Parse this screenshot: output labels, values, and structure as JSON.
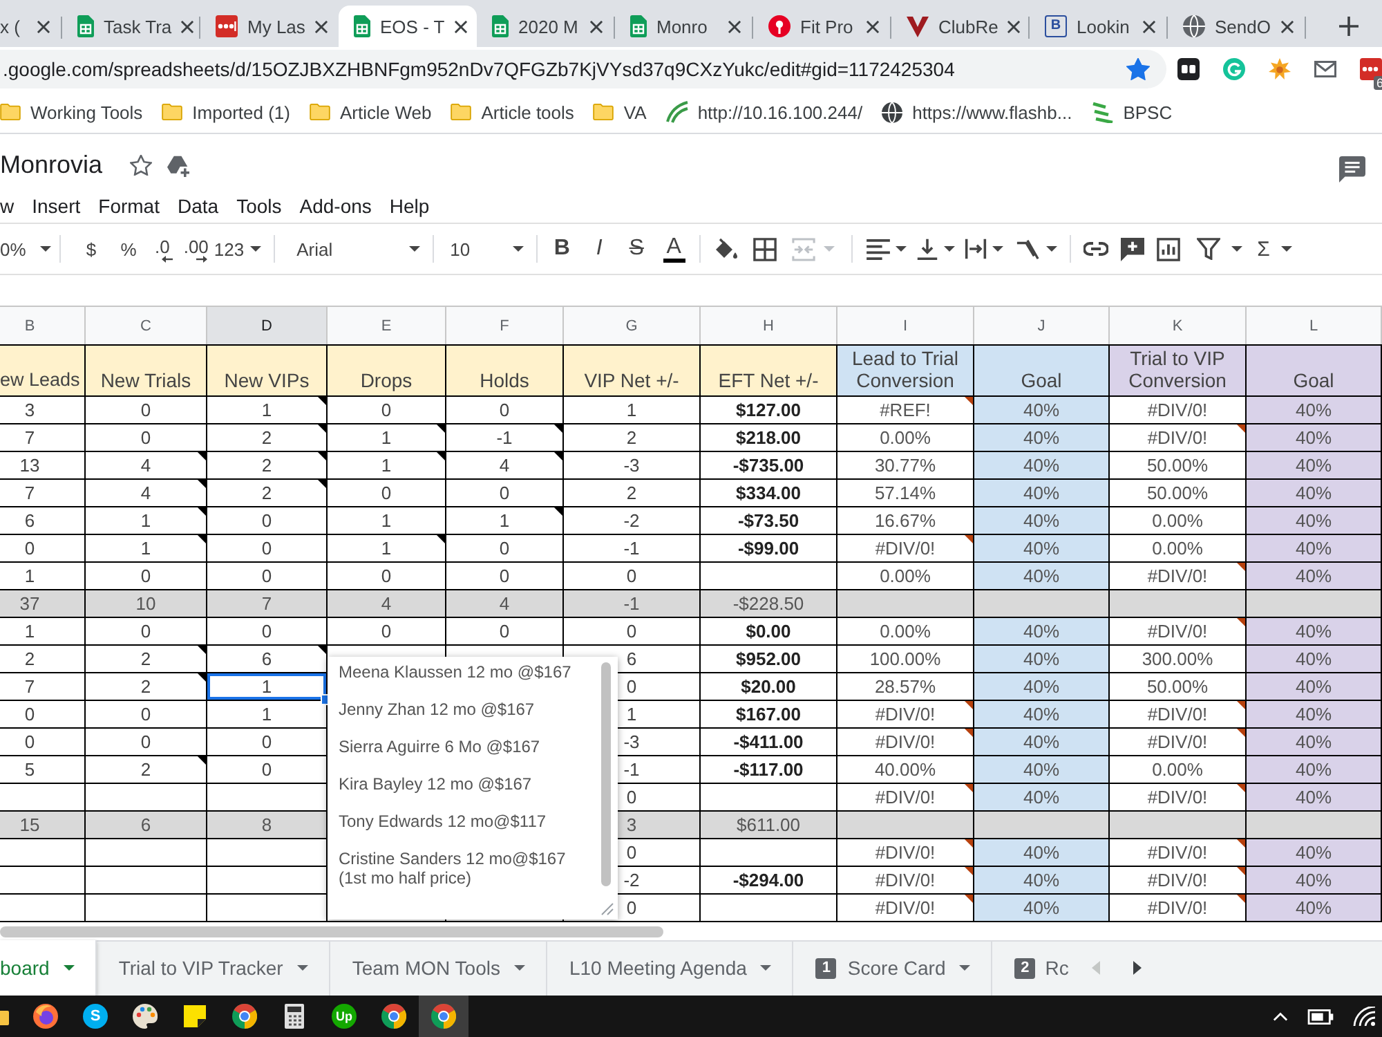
{
  "browser": {
    "tabs": [
      {
        "title": "x (",
        "kind": "none",
        "selected": false
      },
      {
        "title": "Task Tra",
        "kind": "sheets",
        "selected": false
      },
      {
        "title": "My Las",
        "kind": "dots",
        "selected": false
      },
      {
        "title": "EOS - T",
        "kind": "sheets",
        "selected": true
      },
      {
        "title": "2020 M",
        "kind": "sheets",
        "selected": false
      },
      {
        "title": "Monro",
        "kind": "sheets",
        "selected": false
      },
      {
        "title": "Fit Pro",
        "kind": "pin",
        "selected": false
      },
      {
        "title": "ClubRe",
        "kind": "vmark",
        "selected": false
      },
      {
        "title": "Lookin",
        "kind": "letter",
        "letter": "B",
        "selected": false
      },
      {
        "title": "SendO",
        "kind": "globe",
        "selected": false
      }
    ],
    "url": ".google.com/spreadsheets/d/15OZJBXZHBNFgm952nDv7QFGZb7KjVYsd37q9CXzYukc/edit#gid=1172425304",
    "bookmarked": true,
    "extension_badge": "6",
    "bookmarks": [
      {
        "label": "Working Tools",
        "kind": "folder"
      },
      {
        "label": "Imported (1)",
        "kind": "folder"
      },
      {
        "label": "Article Web",
        "kind": "folder"
      },
      {
        "label": "Article tools",
        "kind": "folder"
      },
      {
        "label": "VA",
        "kind": "folder"
      },
      {
        "label": "http://10.16.100.244/",
        "kind": "swoosh"
      },
      {
        "label": "https://www.flashb...",
        "kind": "globe"
      },
      {
        "label": "BPSC",
        "kind": "stripes"
      }
    ]
  },
  "document": {
    "title": "Monrovia",
    "starred": false,
    "menu": [
      "w",
      "Insert",
      "Format",
      "Data",
      "Tools",
      "Add-ons",
      "Help"
    ],
    "toolbar": {
      "zoom": "0%",
      "currency": "$",
      "percent": "%",
      "decimals_less": ".0",
      "decimals_more": ".00",
      "number_format": "123",
      "font": "Arial",
      "font_size": "10",
      "bold": "B",
      "italic": "I",
      "strikethrough": "S",
      "text_color": "A",
      "merge_disabled": true,
      "functions": "Σ"
    }
  },
  "sheet": {
    "columns": [
      {
        "letter": "B",
        "header": "ew Leads",
        "color": "#fff2cc",
        "filled": false,
        "selected": false
      },
      {
        "letter": "C",
        "header": "New Trials",
        "color": "#fff2cc",
        "filled": false,
        "selected": false
      },
      {
        "letter": "D",
        "header": "New VIPs",
        "color": "#fff2cc",
        "filled": false,
        "selected": true
      },
      {
        "letter": "E",
        "header": "Drops",
        "color": "#fff2cc",
        "filled": false,
        "selected": false
      },
      {
        "letter": "F",
        "header": "Holds",
        "color": "#fff2cc",
        "filled": false,
        "selected": false
      },
      {
        "letter": "G",
        "header": "VIP Net +/-",
        "color": "#fff2cc",
        "filled": false,
        "selected": false
      },
      {
        "letter": "H",
        "header": "EFT Net +/-",
        "color": "#fff2cc",
        "filled": false,
        "selected": false
      },
      {
        "letter": "I",
        "header": "Lead to Trial Conversion",
        "color": "#cfe2f3",
        "filled": false,
        "selected": false
      },
      {
        "letter": "J",
        "header": "Goal",
        "color": "#cfe2f3",
        "filled": true,
        "selected": false
      },
      {
        "letter": "K",
        "header": "Trial to VIP Conversion",
        "color": "#d9d2e9",
        "filled": false,
        "selected": false
      },
      {
        "letter": "L",
        "header": "Goal",
        "color": "#d9d2e9",
        "filled": true,
        "selected": false
      }
    ],
    "rows": [
      {
        "kind": "data",
        "cells": [
          "3",
          "0",
          {
            "text": "1",
            "note": true
          },
          "0",
          "0",
          "1",
          "$127.00",
          {
            "text": "#REF!",
            "comment": true
          },
          "40%",
          "#DIV/0!",
          "40%"
        ]
      },
      {
        "kind": "data",
        "cells": [
          "7",
          "0",
          {
            "text": "2",
            "note": true
          },
          {
            "text": "1",
            "note": true
          },
          {
            "text": "-1",
            "note": true
          },
          "2",
          "$218.00",
          "0.00%",
          "40%",
          {
            "text": "#DIV/0!",
            "comment": true
          },
          "40%"
        ]
      },
      {
        "kind": "data",
        "cells": [
          "13",
          {
            "text": "4",
            "note": true
          },
          {
            "text": "2",
            "note": true
          },
          {
            "text": "1",
            "note": true
          },
          {
            "text": "4",
            "note": true
          },
          "-3",
          "-$735.00",
          "30.77%",
          "40%",
          "50.00%",
          "40%"
        ]
      },
      {
        "kind": "data",
        "cells": [
          "7",
          {
            "text": "4",
            "note": true
          },
          {
            "text": "2",
            "note": true
          },
          "0",
          "0",
          "2",
          "$334.00",
          "57.14%",
          "40%",
          "50.00%",
          "40%"
        ]
      },
      {
        "kind": "data",
        "cells": [
          "6",
          {
            "text": "1",
            "note": true
          },
          "0",
          "1",
          {
            "text": "1",
            "note": true
          },
          "-2",
          "-$73.50",
          "16.67%",
          "40%",
          "0.00%",
          "40%"
        ]
      },
      {
        "kind": "data",
        "cells": [
          "0",
          {
            "text": "1",
            "note": true
          },
          "0",
          {
            "text": "1",
            "note": true
          },
          "0",
          "-1",
          "-$99.00",
          {
            "text": "#DIV/0!",
            "comment": true
          },
          "40%",
          "0.00%",
          "40%"
        ]
      },
      {
        "kind": "data",
        "cells": [
          "1",
          "0",
          "0",
          "0",
          "0",
          "0",
          null,
          "0.00%",
          "40%",
          {
            "text": "#DIV/0!",
            "comment": true
          },
          "40%"
        ]
      },
      {
        "kind": "total",
        "cells": [
          "37",
          "10",
          "7",
          "4",
          "4",
          "-1",
          "-$228.50",
          null,
          null,
          null,
          null
        ]
      },
      {
        "kind": "data",
        "cells": [
          "1",
          "0",
          "0",
          "0",
          "0",
          "0",
          "$0.00",
          "0.00%",
          "40%",
          {
            "text": "#DIV/0!",
            "comment": true
          },
          "40%"
        ]
      },
      {
        "kind": "data",
        "cells": [
          "2",
          {
            "text": "2",
            "note": true
          },
          {
            "text": "6",
            "note": true
          },
          null,
          null,
          "6",
          "$952.00",
          "100.00%",
          "40%",
          "300.00%",
          "40%"
        ]
      },
      {
        "kind": "data",
        "cells": [
          "7",
          {
            "text": "2",
            "note": true
          },
          {
            "text": "1",
            "selected": true
          },
          null,
          null,
          "0",
          "$20.00",
          "28.57%",
          "40%",
          "50.00%",
          "40%"
        ]
      },
      {
        "kind": "data",
        "cells": [
          "0",
          "0",
          "1",
          null,
          null,
          "1",
          "$167.00",
          {
            "text": "#DIV/0!",
            "comment": true
          },
          "40%",
          {
            "text": "#DIV/0!",
            "comment": true
          },
          "40%"
        ]
      },
      {
        "kind": "data",
        "cells": [
          "0",
          "0",
          "0",
          null,
          null,
          "-3",
          "-$411.00",
          {
            "text": "#DIV/0!",
            "comment": true
          },
          "40%",
          {
            "text": "#DIV/0!",
            "comment": true
          },
          "40%"
        ]
      },
      {
        "kind": "data",
        "cells": [
          "5",
          {
            "text": "2",
            "note": true
          },
          "0",
          null,
          null,
          "-1",
          "-$117.00",
          "40.00%",
          "40%",
          "0.00%",
          "40%"
        ]
      },
      {
        "kind": "data",
        "cells": [
          null,
          null,
          null,
          null,
          null,
          "0",
          null,
          {
            "text": "#DIV/0!",
            "comment": true
          },
          "40%",
          {
            "text": "#DIV/0!",
            "comment": true
          },
          "40%"
        ]
      },
      {
        "kind": "total",
        "cells": [
          "15",
          "6",
          "8",
          null,
          null,
          "3",
          "$611.00",
          null,
          null,
          null,
          null
        ]
      },
      {
        "kind": "data",
        "cells": [
          null,
          null,
          null,
          null,
          null,
          "0",
          null,
          {
            "text": "#DIV/0!",
            "comment": true
          },
          "40%",
          {
            "text": "#DIV/0!",
            "comment": true
          },
          "40%"
        ]
      },
      {
        "kind": "data",
        "cells": [
          null,
          null,
          null,
          null,
          null,
          "-2",
          "-$294.00",
          {
            "text": "#DIV/0!",
            "comment": true
          },
          "40%",
          {
            "text": "#DIV/0!",
            "comment": true
          },
          "40%"
        ]
      },
      {
        "kind": "data",
        "cells": [
          null,
          null,
          null,
          null,
          null,
          "0",
          null,
          {
            "text": "#DIV/0!",
            "comment": true
          },
          "40%",
          {
            "text": "#DIV/0!",
            "comment": true
          },
          "40%"
        ]
      }
    ],
    "note": {
      "lines": [
        "Meena Klaussen 12 mo @$167",
        "Jenny Zhan 12 mo @$167",
        "Sierra Aguirre 6 Mo @$167",
        "Kira Bayley 12 mo @$167",
        "Tony Edwards 12 mo@$117",
        "Cristine Sanders 12 mo@$167 (1st mo half price)"
      ]
    }
  },
  "sheet_tabs": [
    {
      "label": "board",
      "selected": true
    },
    {
      "label": "Trial to VIP Tracker",
      "selected": false
    },
    {
      "label": "Team MON Tools",
      "selected": false
    },
    {
      "label": "L10 Meeting Agenda",
      "selected": false
    },
    {
      "label": "Score Card",
      "badge": "1",
      "selected": false
    },
    {
      "label": "Rc",
      "badge": "2",
      "selected": false
    }
  ],
  "sheet_scroll": {
    "left_disabled": true,
    "right_disabled": false
  },
  "taskbar": {
    "apps": [
      {
        "kind": "folder",
        "selected": false
      },
      {
        "kind": "flame",
        "selected": false
      },
      {
        "kind": "chat",
        "label": "S",
        "selected": false
      },
      {
        "kind": "palette",
        "selected": false
      },
      {
        "kind": "sticky",
        "selected": false
      },
      {
        "kind": "aperture",
        "selected": false
      },
      {
        "kind": "calculator",
        "selected": false
      },
      {
        "kind": "jobs",
        "label": "Up",
        "selected": false
      },
      {
        "kind": "aperture",
        "selected": false
      },
      {
        "kind": "aperture",
        "selected": true
      }
    ]
  }
}
